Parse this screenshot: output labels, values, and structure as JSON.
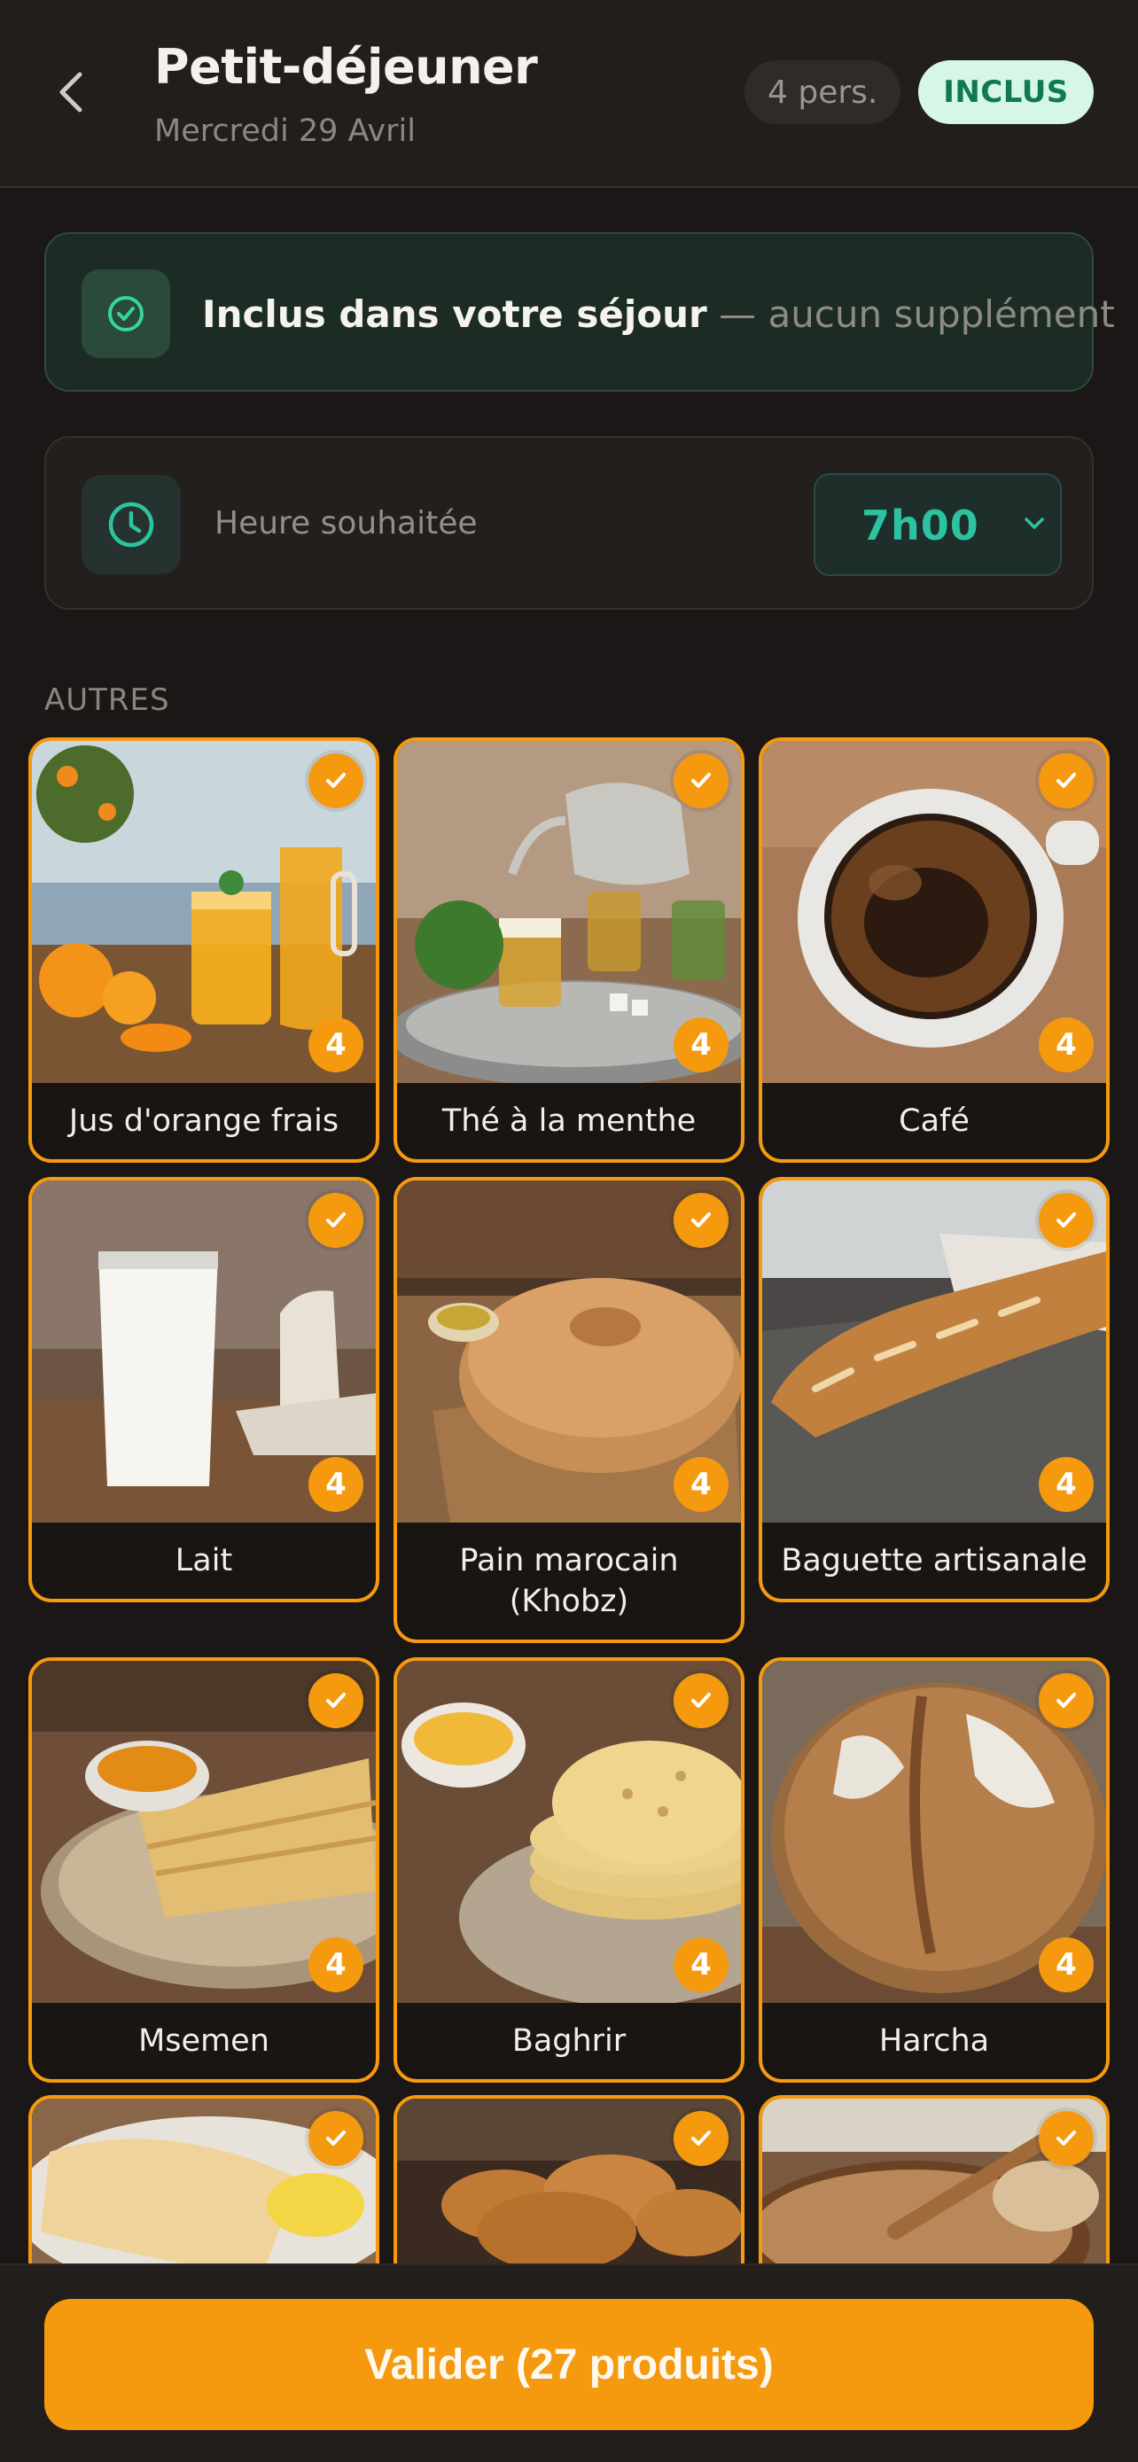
{
  "header": {
    "title": "Petit-déjeuner",
    "subtitle": "Mercredi 29 Avril",
    "persons_badge": "4 pers.",
    "status_badge": "INCLUS"
  },
  "included_notice": {
    "bold": "Inclus dans votre séjour",
    "rest": " — aucun supplément"
  },
  "time_picker": {
    "label": "Heure souhaitée",
    "value": "7h00"
  },
  "section": {
    "label": "AUTRES"
  },
  "products": [
    {
      "name": "Jus d'orange frais",
      "qty": "4",
      "icon": "orange-juice"
    },
    {
      "name": "Thé à la menthe",
      "qty": "4",
      "icon": "mint-tea"
    },
    {
      "name": "Café",
      "qty": "4",
      "icon": "coffee-cup"
    },
    {
      "name": "Lait",
      "qty": "4",
      "icon": "milk-glass"
    },
    {
      "name": "Pain marocain (Khobz)",
      "qty": "4",
      "icon": "round-bread"
    },
    {
      "name": "Baguette artisanale",
      "qty": "4",
      "icon": "baguette"
    },
    {
      "name": "Msemen",
      "qty": "4",
      "icon": "msemen"
    },
    {
      "name": "Baghrir",
      "qty": "4",
      "icon": "baghrir"
    },
    {
      "name": "Harcha",
      "qty": "4",
      "icon": "harcha"
    },
    {
      "name": "",
      "qty": "",
      "icon": "crepes"
    },
    {
      "name": "",
      "qty": "",
      "icon": "croissants"
    },
    {
      "name": "",
      "qty": "",
      "icon": "porridge"
    }
  ],
  "cta": {
    "label": "Valider (27 produits)"
  },
  "colors": {
    "accent": "#f59a0f",
    "success": "#2cc4a0",
    "background": "#1a1716"
  }
}
